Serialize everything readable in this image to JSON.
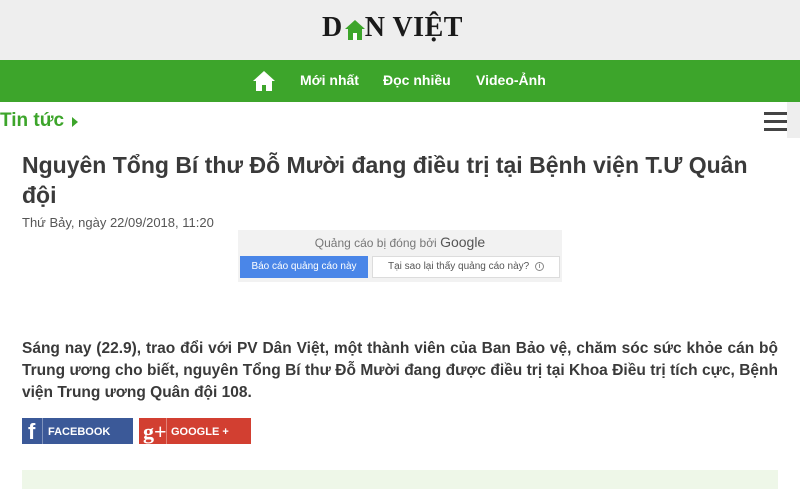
{
  "header": {
    "logo_left": "D",
    "logo_right": "N VIỆT",
    "logo_icon": "house-icon"
  },
  "nav": {
    "home_icon": "home-icon",
    "items": [
      "Mới nhất",
      "Đọc nhiều",
      "Video-Ảnh"
    ]
  },
  "section": {
    "label": "Tin tức",
    "arrow_icon": "caret-right-icon",
    "menu_icon": "hamburger-menu-icon"
  },
  "article": {
    "title": "Nguyên Tổng Bí thư Đỗ Mười đang điều trị tại Bệnh viện T.Ư Quân đội",
    "date": "Thứ Bảy, ngày 22/09/2018, 11:20",
    "lead": "Sáng nay (22.9), trao đổi với PV Dân Việt, một thành viên của Ban Bảo vệ, chăm sóc sức khỏe cán bộ Trung ương cho biết, nguyên Tổng Bí thư Đỗ Mười đang được điều trị tại Khoa Điều trị tích cực, Bệnh viện Trung ương Quân đội 108."
  },
  "ad": {
    "closed_text": "Quảng cáo bị đóng bởi",
    "closed_brand": "Google",
    "report_label": "Báo cáo quảng cáo này",
    "why_label": "Tại sao lại thấy quảng cáo này?",
    "info_glyph": "i"
  },
  "share": {
    "facebook_glyph": "f",
    "facebook_label": "FACEBOOK",
    "google_glyph": "g+",
    "google_label": "GOOGLE +"
  },
  "colors": {
    "brand_green": "#3da52b",
    "facebook_blue": "#3b5998",
    "google_red": "#d23f31",
    "ad_button_blue": "#4a86e8"
  }
}
